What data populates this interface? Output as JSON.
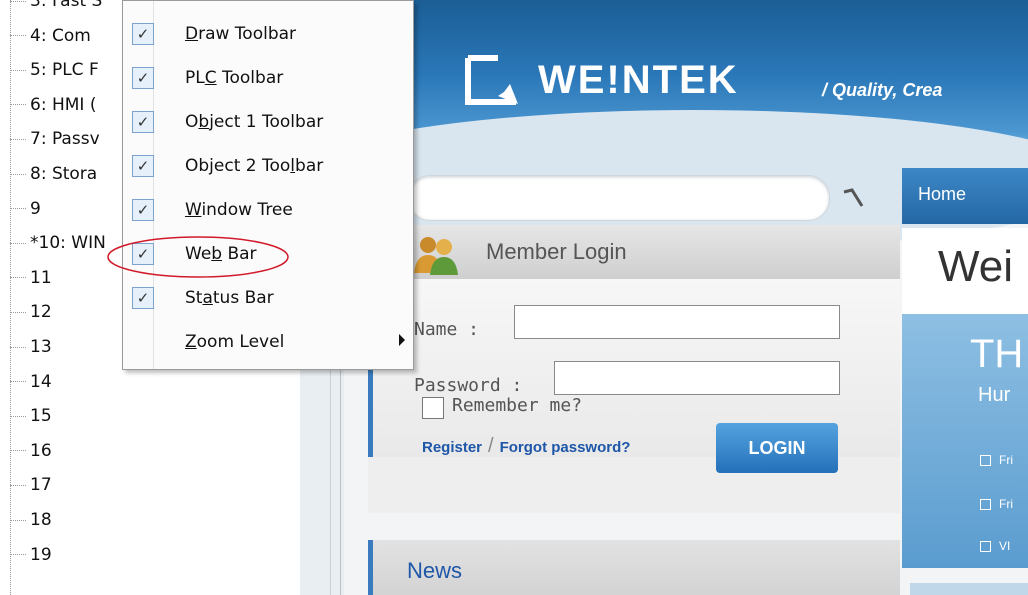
{
  "tree": {
    "items": [
      "3: Fast S",
      "4: Com",
      "5: PLC F",
      "6: HMI (",
      "7: Passv",
      "8: Stora",
      "9",
      "*10: WIN",
      "11",
      "12",
      "13",
      "14",
      "15",
      "16",
      "17",
      "18",
      "19"
    ]
  },
  "context_menu": {
    "items": [
      {
        "pre": "",
        "u": "D",
        "post": "raw Toolbar",
        "checked": true
      },
      {
        "pre": "PL",
        "u": "C",
        "post": " Toolbar",
        "checked": true
      },
      {
        "pre": "O",
        "u": "b",
        "post": "ject 1 Toolbar",
        "checked": true
      },
      {
        "pre": "Object 2 Too",
        "u": "l",
        "post": "bar",
        "checked": true
      },
      {
        "pre": "",
        "u": "W",
        "post": "indow Tree",
        "checked": true
      },
      {
        "pre": "We",
        "u": "b",
        "post": " Bar",
        "checked": true
      },
      {
        "pre": "St",
        "u": "a",
        "post": "tus Bar",
        "checked": true
      },
      {
        "pre": "",
        "u": "Z",
        "post": "oom Level",
        "checked": false,
        "submenu": true
      }
    ],
    "check_glyph": "✓",
    "highlight_color": "#d11a2a"
  },
  "web": {
    "logo_text": "WE!NTEK",
    "slogan": "/ Quality, Crea",
    "menu_home": "Home",
    "member_login": "Member Login",
    "name_label": "Name :",
    "password_label": "Password :",
    "remember_label": "Remember me?",
    "login_button": "LOGIN",
    "register_link": "Register",
    "separator": "/",
    "forgot_link": "Forgot password?",
    "news_title": "News",
    "right_title": "Wei",
    "right_big": "TH",
    "right_sub": "Hur",
    "right_bullets": [
      "Fri",
      "Fri",
      "VI"
    ],
    "accent": "#2a77b8"
  }
}
